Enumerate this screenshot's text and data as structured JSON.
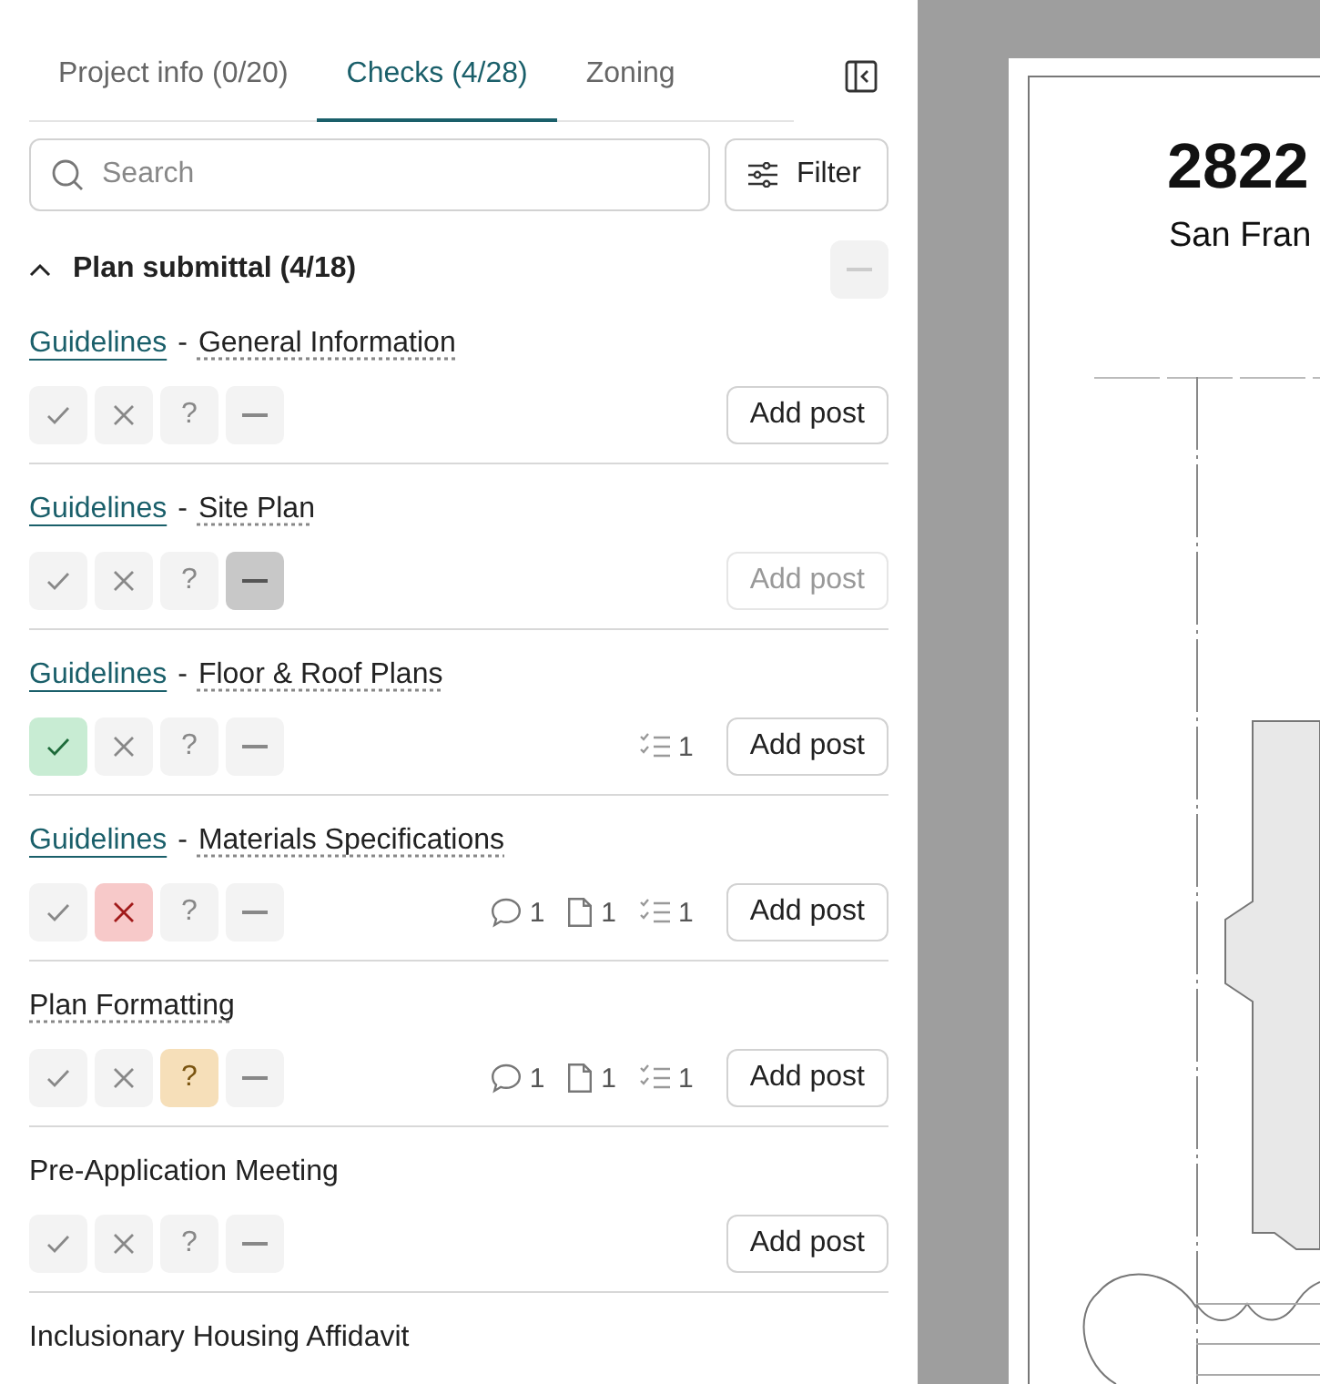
{
  "tabs": [
    {
      "label": "Project info (0/20)",
      "selected": false
    },
    {
      "label": "Checks (4/28)",
      "selected": true
    },
    {
      "label": "Zoning",
      "selected": false
    }
  ],
  "search": {
    "placeholder": "Search"
  },
  "filter_button": "Filter",
  "section": {
    "title": "Plan submittal (4/18)",
    "expanded": true
  },
  "checks": [
    {
      "link": "Guidelines",
      "separator": "-",
      "title": "General Information",
      "buttons": [
        {
          "kind": "pass",
          "selected": false
        },
        {
          "kind": "fail",
          "selected": false
        },
        {
          "kind": "unknown",
          "label": "?",
          "selected": false
        },
        {
          "kind": "na",
          "selected": false
        }
      ],
      "add_post": {
        "label": "Add post",
        "disabled": false
      }
    },
    {
      "link": "Guidelines",
      "separator": "-",
      "title": "Site Plan",
      "buttons": [
        {
          "kind": "pass",
          "selected": false
        },
        {
          "kind": "fail",
          "selected": false
        },
        {
          "kind": "unknown",
          "label": "?",
          "selected": false
        },
        {
          "kind": "na",
          "selected": true
        }
      ],
      "add_post": {
        "label": "Add post",
        "disabled": true
      }
    },
    {
      "link": "Guidelines",
      "separator": "-",
      "title": "Floor & Roof Plans",
      "buttons": [
        {
          "kind": "pass",
          "selected": true
        },
        {
          "kind": "fail",
          "selected": false
        },
        {
          "kind": "unknown",
          "label": "?",
          "selected": false
        },
        {
          "kind": "na",
          "selected": false
        }
      ],
      "counts": [
        {
          "kind": "tasks",
          "value": "1"
        }
      ],
      "add_post": {
        "label": "Add post",
        "disabled": false
      }
    },
    {
      "link": "Guidelines",
      "separator": "-",
      "title": "Materials Specifications",
      "buttons": [
        {
          "kind": "pass",
          "selected": false
        },
        {
          "kind": "fail",
          "selected": true
        },
        {
          "kind": "unknown",
          "label": "?",
          "selected": false
        },
        {
          "kind": "na",
          "selected": false
        }
      ],
      "counts": [
        {
          "kind": "comments",
          "value": "1"
        },
        {
          "kind": "files",
          "value": "1"
        },
        {
          "kind": "tasks",
          "value": "1"
        }
      ],
      "add_post": {
        "label": "Add post",
        "disabled": false
      }
    },
    {
      "title": "Plan Formatting",
      "dotted": true,
      "buttons": [
        {
          "kind": "pass",
          "selected": false
        },
        {
          "kind": "fail",
          "selected": false
        },
        {
          "kind": "unknown",
          "label": "?",
          "selected": true
        },
        {
          "kind": "na",
          "selected": false
        }
      ],
      "counts": [
        {
          "kind": "comments",
          "value": "1"
        },
        {
          "kind": "files",
          "value": "1"
        },
        {
          "kind": "tasks",
          "value": "1"
        }
      ],
      "add_post": {
        "label": "Add post",
        "disabled": false
      }
    },
    {
      "title": "Pre-Application Meeting",
      "dotted": false,
      "buttons": [
        {
          "kind": "pass",
          "selected": false
        },
        {
          "kind": "fail",
          "selected": false
        },
        {
          "kind": "unknown",
          "label": "?",
          "selected": false
        },
        {
          "kind": "na",
          "selected": false
        }
      ],
      "add_post": {
        "label": "Add post",
        "disabled": false
      }
    },
    {
      "title": "Inclusionary Housing Affidavit",
      "dotted": false
    }
  ],
  "preview": {
    "title": "2822",
    "subtitle": "San Fran"
  }
}
